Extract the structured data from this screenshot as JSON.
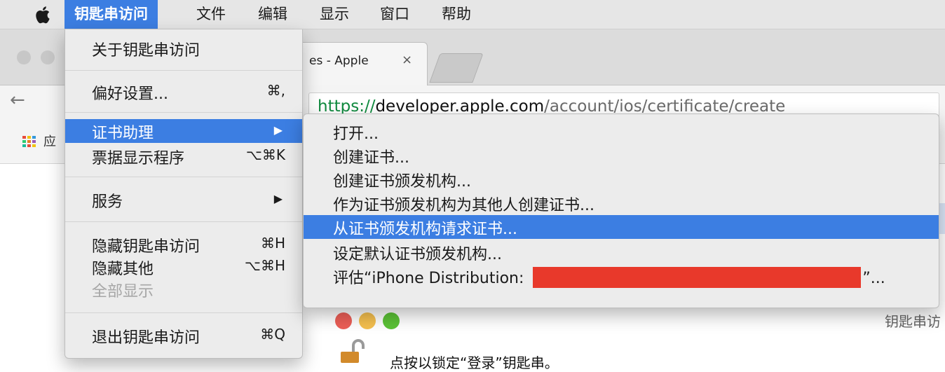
{
  "menubar": {
    "apple_icon": "apple-logo",
    "items": [
      "钥匙串访问",
      "文件",
      "编辑",
      "显示",
      "窗口",
      "帮助"
    ]
  },
  "browser": {
    "tab_title": "es - Apple",
    "tab_close": "×",
    "url_scheme": "https://",
    "url_host": "developer.apple.com",
    "url_path": "/account/ios/certificate/create",
    "bookmark_label": "应"
  },
  "app_menu": {
    "items": [
      {
        "label": "关于钥匙串访问",
        "shortcut": ""
      },
      {
        "label": "偏好设置...",
        "shortcut": "⌘,"
      },
      {
        "label": "证书助理",
        "shortcut": "",
        "submenu_arrow": "▶"
      },
      {
        "label": "票据显示程序",
        "shortcut": "⌥⌘K"
      },
      {
        "label": "服务",
        "shortcut": "",
        "submenu_arrow": "▶"
      },
      {
        "label": "隐藏钥匙串访问",
        "shortcut": "⌘H"
      },
      {
        "label": "隐藏其他",
        "shortcut": "⌥⌘H"
      },
      {
        "label": "全部显示",
        "shortcut": ""
      },
      {
        "label": "退出钥匙串访问",
        "shortcut": "⌘Q"
      }
    ]
  },
  "submenu": {
    "items": [
      "打开...",
      "创建证书...",
      "创建证书颁发机构...",
      "作为证书颁发机构为其他人创建证书...",
      "从证书颁发机构请求证书...",
      "设定默认证书颁发机构..."
    ],
    "evaluate_prefix": "评估“iPhone Distribution: ",
    "evaluate_suffix": "”..."
  },
  "keychain_window": {
    "title": "钥匙串访",
    "lock_text": "点按以锁定“登录”钥匙串。"
  },
  "colors": {
    "highlight": "#3c7ee2",
    "redaction": "#e8392b",
    "traffic_red": "#ec5f57",
    "traffic_yellow": "#f4bf4f",
    "traffic_green": "#5bc236"
  }
}
